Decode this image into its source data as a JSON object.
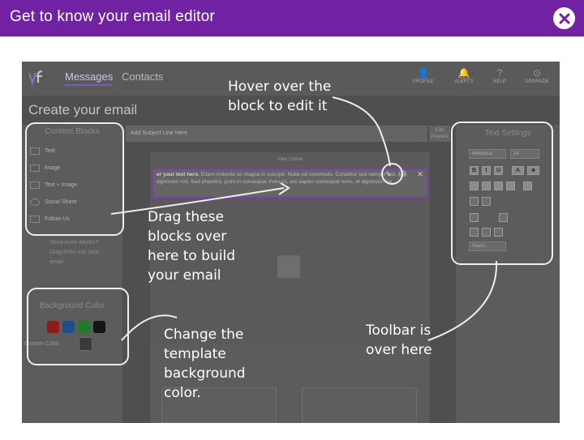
{
  "header": {
    "title": "Get to know your email editor",
    "close_icon": "close-icon",
    "bg_color": "#7022a3"
  },
  "app": {
    "tabs": [
      {
        "label": "Messages",
        "active": true
      },
      {
        "label": "Contacts",
        "active": false
      }
    ],
    "top_icons": [
      {
        "label": "PROFILE",
        "icon": "person-icon",
        "glyph": "👤"
      },
      {
        "label": "ALERTS",
        "icon": "bell-icon",
        "glyph": "🔔"
      },
      {
        "label": "HELP",
        "icon": "question-icon",
        "glyph": "?"
      },
      {
        "label": "UPGRADE",
        "icon": "upgrade-icon",
        "glyph": "⊙"
      }
    ],
    "page_title": "Create your email",
    "content_blocks": {
      "title": "Content Blocks",
      "items": [
        "Text",
        "Image",
        "Text + Image",
        "Social Share",
        "Follow Us"
      ],
      "hint": "Need more blocks? Drag them into your email."
    },
    "background_color": {
      "title": "Background Color",
      "swatches": [
        "#8b1d1d",
        "#1d4e8f",
        "#1f7a2a",
        "#151515"
      ],
      "custom_label": "Custom Color"
    },
    "editor": {
      "subject_placeholder": "Add Subject Line Here",
      "edit_preview": "Edit Preview",
      "view_online": "View Online",
      "text_block_bold": "er your text here.",
      "text_block_body": " Etiam molestie ac magna in suscipit. Nulla vel commodo. Curabitur sed semper nisl, non dignissim nisl. Sed pharetra, justo in consequat rhoncus, est sapien consequat nunc, et dignissim est."
    },
    "text_settings": {
      "title": "Text Settings",
      "font": "Helvetica",
      "size": "14",
      "format_buttons": [
        "B",
        "I",
        "U",
        "A",
        "■"
      ],
      "insert_label": "Insert..."
    }
  },
  "callouts": {
    "hover": "Hover over the block to edit it",
    "drag": "Drag these blocks over here to build your email",
    "bg": "Change the template background color.",
    "toolbar": "Toolbar is over here"
  }
}
